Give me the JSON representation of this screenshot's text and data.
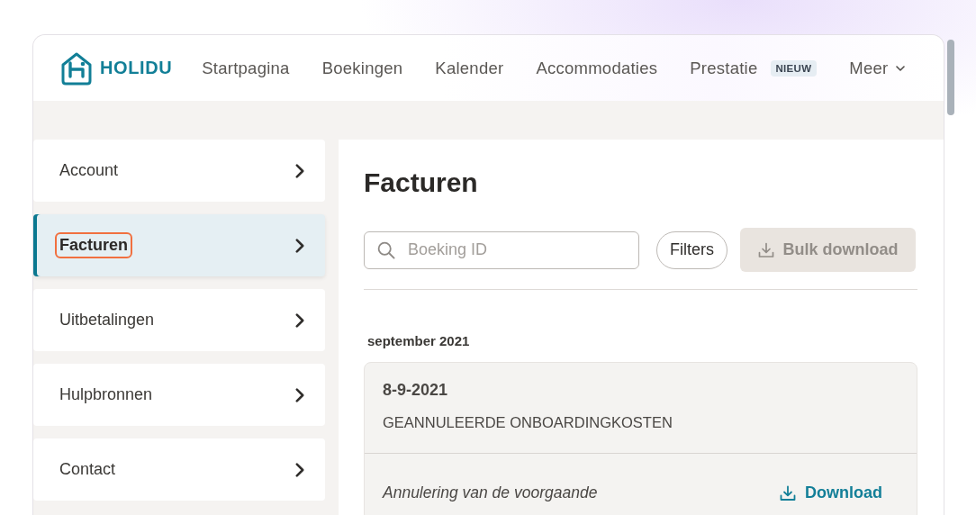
{
  "header": {
    "logo": {
      "text": "HOLIDU"
    },
    "nav": [
      {
        "label": "Startpagina",
        "kind": "link"
      },
      {
        "label": "Boekingen",
        "kind": "link"
      },
      {
        "label": "Kalender",
        "kind": "link"
      },
      {
        "label": "Accommodaties",
        "kind": "link"
      },
      {
        "label": "Prestatie",
        "kind": "link",
        "badge": "NIEUW"
      },
      {
        "label": "Meer",
        "kind": "dropdown"
      }
    ]
  },
  "sidebar": {
    "items": [
      {
        "label": "Account",
        "selected": false,
        "focused": false
      },
      {
        "label": "Facturen",
        "selected": true,
        "focused": true
      },
      {
        "label": "Uitbetalingen",
        "selected": false,
        "focused": false
      },
      {
        "label": "Hulpbronnen",
        "selected": false,
        "focused": false
      },
      {
        "label": "Contact",
        "selected": false,
        "focused": false
      }
    ]
  },
  "main": {
    "title": "Facturen",
    "search": {
      "placeholder": "Boeking ID"
    },
    "filters_button": "Filters",
    "bulk_download": {
      "label": "Bulk download",
      "disabled": true
    },
    "groups": [
      {
        "heading": "september 2021",
        "invoices": [
          {
            "date": "8-9-2021",
            "type": "GEANNULEERDE ONBOARDINGKOSTEN",
            "description": "Annulering van de voorgaande",
            "download": "Download"
          }
        ]
      }
    ]
  }
}
